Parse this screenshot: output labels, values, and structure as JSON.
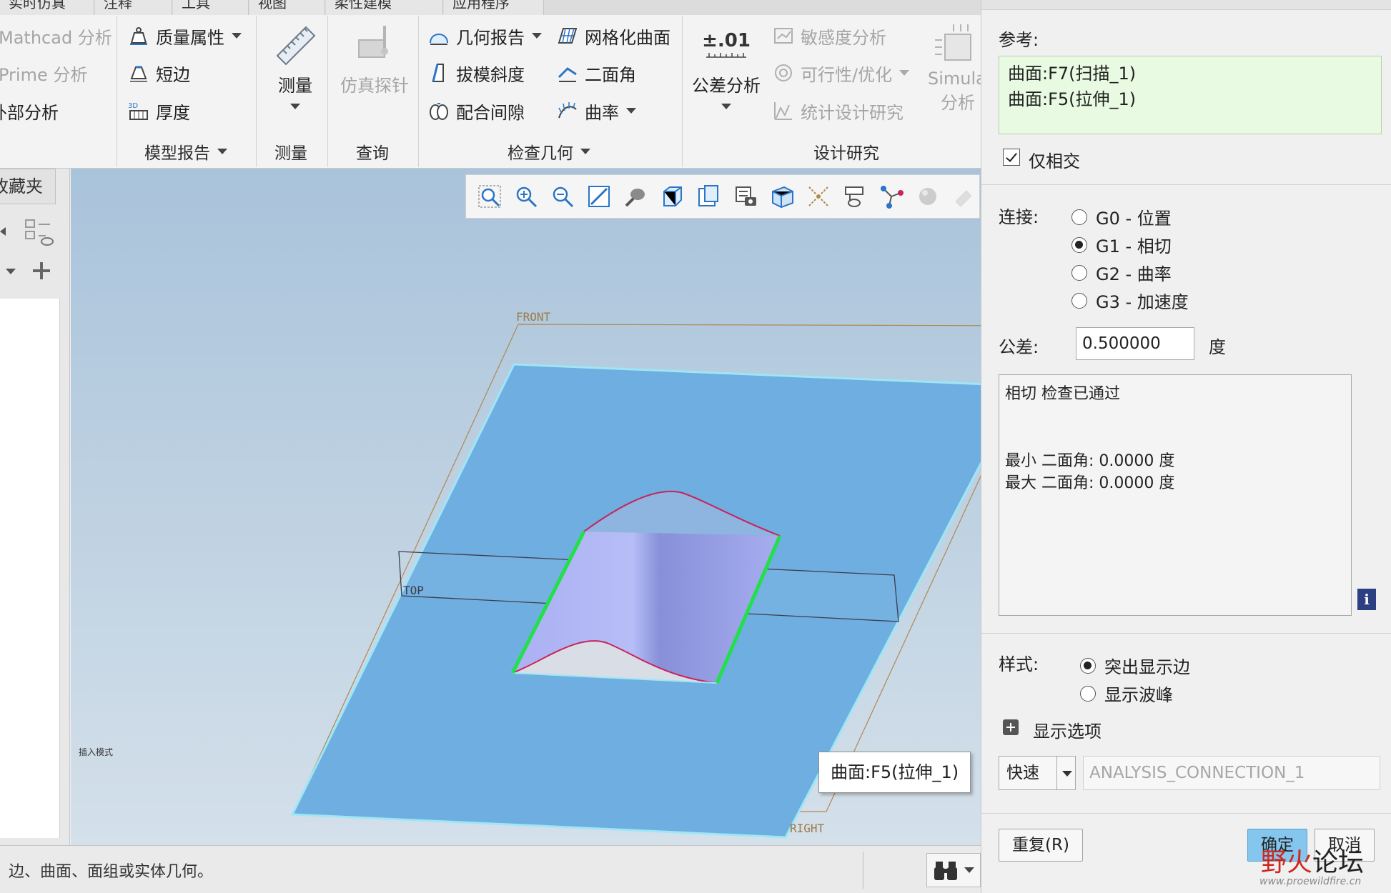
{
  "ribbon": {
    "top_tabs": [
      "实时仿真",
      "注释",
      "工具",
      "视图",
      "柔性建模",
      "应用程序"
    ],
    "col_a": [
      "Mathcad 分析",
      "Prime 分析",
      "外部分析"
    ],
    "model_report": {
      "items": [
        "质量属性",
        "短边",
        "厚度"
      ],
      "group_label": "模型报告"
    },
    "measure": {
      "button": "测量",
      "group_label": "测量"
    },
    "query": {
      "button": "仿真探针",
      "group_label": "查询"
    },
    "inspect": {
      "left_items": [
        "几何报告",
        "拔模斜度",
        "配合间隙"
      ],
      "right_items": [
        "网格化曲面",
        "二面角",
        "曲率"
      ],
      "group_label": "检查几何"
    },
    "design_study": {
      "tolerance_button": "公差分析",
      "tolerance_icon_text": "±.01",
      "items": [
        "敏感度分析",
        "可行性/优化",
        "统计设计研究"
      ],
      "simulate_button": [
        "Simula",
        "分析"
      ],
      "group_label": "设计研究"
    }
  },
  "left_panel": {
    "tab_label": "收藏夹"
  },
  "viewport": {
    "datum_labels": {
      "front": "FRONT",
      "top": "TOP",
      "right": "RIGHT"
    },
    "mode_text": "插入模式",
    "tooltip": "曲面:F5(拉伸_1)"
  },
  "status_bar": {
    "message": "边、曲面、面组或实体几何。"
  },
  "dialog": {
    "references_label": "参考:",
    "references": [
      "曲面:F7(扫描_1)",
      "曲面:F5(拉伸_1)"
    ],
    "intersect_only": {
      "label": "仅相交",
      "checked": true
    },
    "connection_label": "连接:",
    "connection_options": [
      {
        "label": "G0 - 位置",
        "selected": false
      },
      {
        "label": "G1 - 相切",
        "selected": true
      },
      {
        "label": "G2 - 曲率",
        "selected": false
      },
      {
        "label": "G3 - 加速度",
        "selected": false
      }
    ],
    "tolerance_label": "公差:",
    "tolerance_value": "0.500000",
    "tolerance_unit": "度",
    "result": {
      "line1": "相切 检查已通过",
      "line2": "最小 二面角: 0.0000 度",
      "line3": "最大 二面角: 0.0000 度"
    },
    "style_label": "样式:",
    "style_options": [
      {
        "label": "突出显示边",
        "selected": true
      },
      {
        "label": "显示波峰",
        "selected": false
      }
    ],
    "display_options_label": "显示选项",
    "speed_value": "快速",
    "analysis_name": "ANALYSIS_CONNECTION_1",
    "buttons": {
      "repeat": "重复(R)",
      "ok": "确定",
      "cancel": "取消"
    },
    "watermark": {
      "red": "野火",
      "black": "论坛",
      "url": "www.proewildfire.cn"
    }
  },
  "colors": {
    "viewport_top": "#a9c3db",
    "plane_fill": "#6eaee0",
    "wave_fill": "#a8aef0",
    "edge_highlight": "#22e04a",
    "curve_color": "#c8235a",
    "reference_box": "#e8fbe2",
    "ok_button": "#84c6ee"
  }
}
